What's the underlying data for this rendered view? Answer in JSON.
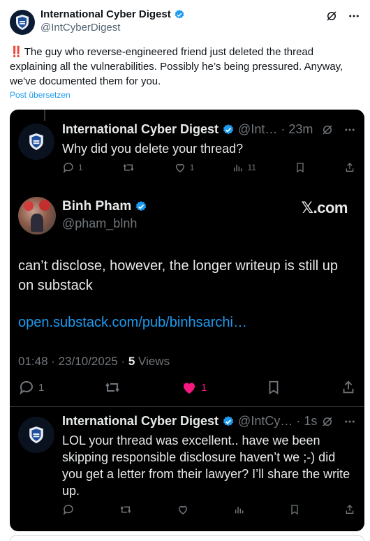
{
  "outer_tweet": {
    "author_name": "International Cyber Digest",
    "author_handle": "@IntCyberDigest",
    "emoji": "‼️",
    "text": "The guy who reverse-engineered friend just deleted the thread explaining all the vulnerabilities. Possibly he’s being pressured. Anyway, we've documented them for you.",
    "translate_label": "Post übersetzen"
  },
  "screenshot": {
    "reply_1": {
      "author_name": "International Cyber Digest",
      "handle_time": "@Int… · 23m",
      "text": "Why did you delete your thread?",
      "replies": "1",
      "likes": "1",
      "views": "11"
    },
    "main_post": {
      "author_name": "Binh Pham",
      "author_handle": "@pham_blnh",
      "brand": "𝕏.com",
      "text": "can’t disclose, however, the longer writeup is still up on substack",
      "link": "open.substack.com/pub/binhsarchi…",
      "timestamp": "01:48 · 23/10/2025 · ",
      "views_count": "5",
      "views_label": " Views",
      "replies": "1",
      "likes": "1",
      "liked_color": "#f91880"
    },
    "reply_2": {
      "author_name": "International Cyber Digest",
      "handle_time": "@IntCy… · 1s",
      "text": "LOL your thread was excellent.. have we been skipping responsible disclosure haven’t we ;-) did you get a letter from their lawyer? I’ll share the write up."
    }
  },
  "colors": {
    "accent": "#1d9bf0",
    "card_bg": "#000000",
    "muted": "#71767b"
  }
}
